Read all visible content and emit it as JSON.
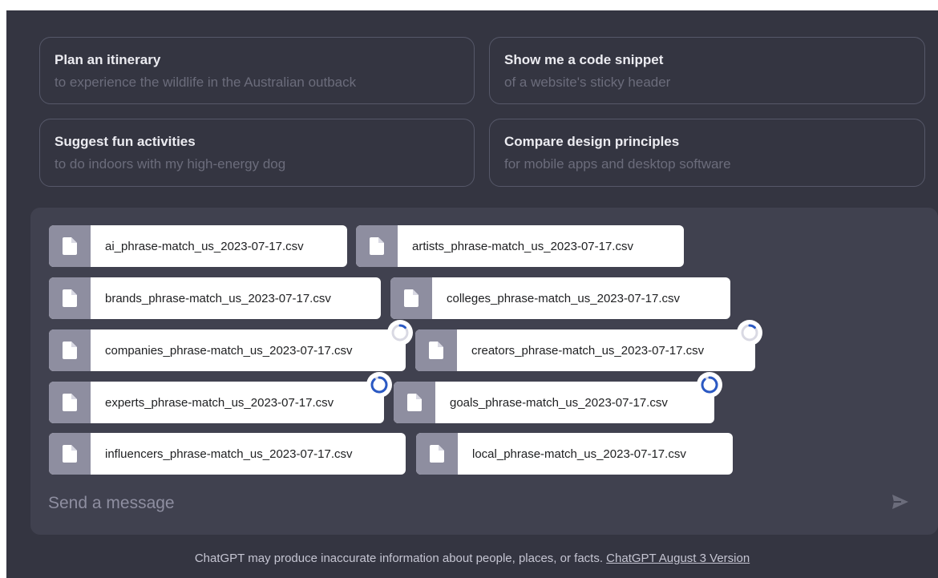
{
  "suggestions": [
    {
      "title": "Plan an itinerary",
      "subtitle": "to experience the wildlife in the Australian outback"
    },
    {
      "title": "Show me a code snippet",
      "subtitle": "of a website's sticky header"
    },
    {
      "title": "Suggest fun activities",
      "subtitle": "to do indoors with my high-energy dog"
    },
    {
      "title": "Compare design principles",
      "subtitle": "for mobile apps and desktop software"
    }
  ],
  "files": [
    {
      "name": "ai_phrase-match_us_2023-07-17.csv",
      "icon": "file-icon",
      "status": "done"
    },
    {
      "name": "artists_phrase-match_us_2023-07-17.csv",
      "icon": "file-icon",
      "status": "done"
    },
    {
      "name": "brands_phrase-match_us_2023-07-17.csv",
      "icon": "file-icon",
      "status": "done"
    },
    {
      "name": "colleges_phrase-match_us_2023-07-17.csv",
      "icon": "file-icon",
      "status": "done"
    },
    {
      "name": "companies_phrase-match_us_2023-07-17.csv",
      "icon": "file-icon",
      "status": "uploading",
      "progress": 0.15
    },
    {
      "name": "creators_phrase-match_us_2023-07-17.csv",
      "icon": "file-icon",
      "status": "uploading",
      "progress": 0.15
    },
    {
      "name": "experts_phrase-match_us_2023-07-17.csv",
      "icon": "file-icon",
      "status": "uploading",
      "progress": 0.85
    },
    {
      "name": "goals_phrase-match_us_2023-07-17.csv",
      "icon": "file-icon",
      "status": "uploading",
      "progress": 0.85
    },
    {
      "name": "influencers_phrase-match_us_2023-07-17.csv",
      "icon": "file-icon",
      "status": "done"
    },
    {
      "name": "local_phrase-match_us_2023-07-17.csv",
      "icon": "file-icon",
      "status": "done"
    }
  ],
  "composer": {
    "placeholder": "Send a message",
    "send_icon": "send-icon"
  },
  "footer": {
    "disclaimer": "ChatGPT may produce inaccurate information about people, places, or facts.",
    "version_link": "ChatGPT August 3 Version"
  },
  "colors": {
    "background": "#343541",
    "composer": "#40414f",
    "chip_icon_bg": "#8e8ea0",
    "spinner_accent": "#2b59c3"
  }
}
